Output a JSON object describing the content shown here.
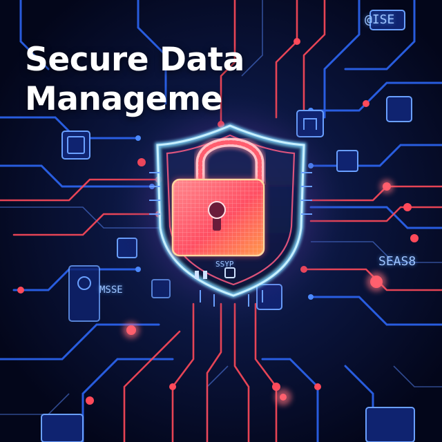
{
  "headline": {
    "line1": "Secure Data",
    "line2": "Manageme"
  },
  "chip_labels": {
    "top_right": "@ISE",
    "right": "SEAS8",
    "left": "MSSE",
    "shield_base": "SSYP"
  },
  "icons": [
    "padlock-icon",
    "shield-icon",
    "circuit-chip-icon",
    "microchip-icon"
  ],
  "colors": {
    "background": "#050a1e",
    "circuit_blue": "#2f6bff",
    "circuit_red": "#ff4a5a",
    "lock_glow": "#ff6f7c",
    "shield_glow": "#7fd6ff",
    "headline": "#ffffff"
  }
}
